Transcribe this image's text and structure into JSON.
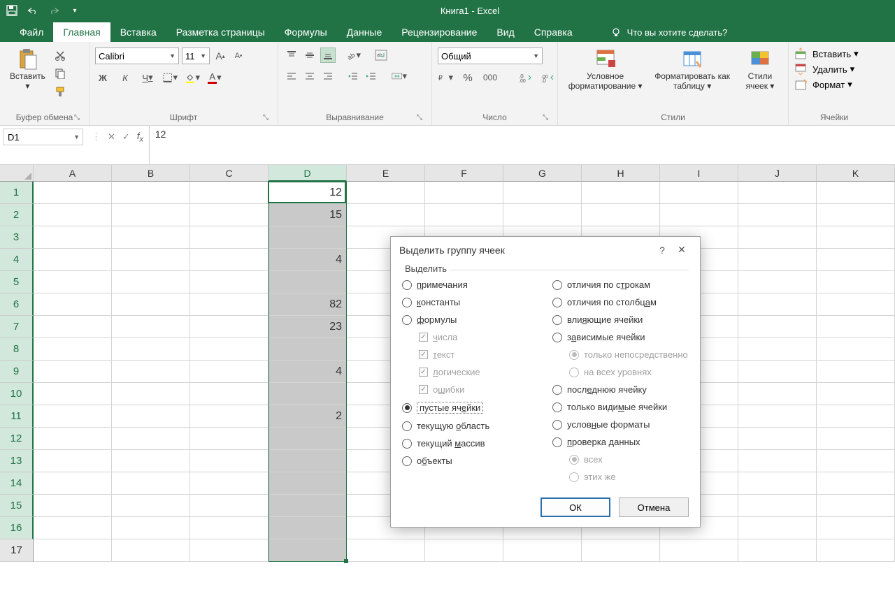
{
  "title": "Книга1  -  Excel",
  "tabs": {
    "file": "Файл",
    "home": "Главная",
    "insert": "Вставка",
    "layout": "Разметка страницы",
    "formulas": "Формулы",
    "data": "Данные",
    "review": "Рецензирование",
    "view": "Вид",
    "help": "Справка"
  },
  "tell_me": "Что вы хотите сделать?",
  "ribbon": {
    "clipboard": {
      "paste": "Вставить",
      "label": "Буфер обмена"
    },
    "font": {
      "name": "Calibri",
      "size": "11",
      "bold": "Ж",
      "italic": "К",
      "under": "Ч",
      "label": "Шрифт"
    },
    "align": {
      "label": "Выравнивание"
    },
    "number": {
      "format": "Общий",
      "label": "Число"
    },
    "styles": {
      "cond": "Условное форматирование",
      "table": "Форматировать как таблицу",
      "cell": "Стили ячеек",
      "label": "Стили"
    },
    "cells": {
      "insert": "Вставить",
      "delete": "Удалить",
      "format": "Формат",
      "label": "Ячейки"
    }
  },
  "namebox": "D1",
  "formula": "12",
  "columns": [
    "A",
    "B",
    "C",
    "D",
    "E",
    "F",
    "G",
    "H",
    "I",
    "J",
    "K"
  ],
  "rows": 17,
  "selected_col_index": 3,
  "data_col": {
    "1": "12",
    "2": "15",
    "3": "",
    "4": "4",
    "5": "",
    "6": "82",
    "7": "23",
    "8": "",
    "9": "4",
    "10": "",
    "11": "2"
  },
  "dialog": {
    "title": "Выделить группу ячеек",
    "frame": "Выделить",
    "left": [
      {
        "type": "radio",
        "label": "примечания",
        "u": 0
      },
      {
        "type": "radio",
        "label": "константы",
        "u": 0
      },
      {
        "type": "radio",
        "label": "формулы",
        "u": 0
      },
      {
        "type": "check",
        "label": "числа",
        "u": 0,
        "indent": true,
        "disabled": true,
        "checked": true
      },
      {
        "type": "check",
        "label": "текст",
        "u": 0,
        "indent": true,
        "disabled": true,
        "checked": true
      },
      {
        "type": "check",
        "label": "логические",
        "u": 0,
        "indent": true,
        "disabled": true,
        "checked": true
      },
      {
        "type": "check",
        "label": "ошибки",
        "u": 1,
        "indent": true,
        "disabled": true,
        "checked": true
      },
      {
        "type": "radio",
        "label": "пустые ячейки",
        "u": 9,
        "selected": true,
        "boxed": true
      },
      {
        "type": "radio",
        "label": "текущую область",
        "u": 8
      },
      {
        "type": "radio",
        "label": "текущий массив",
        "u": 8
      },
      {
        "type": "radio",
        "label": "объекты",
        "u": 1
      }
    ],
    "right": [
      {
        "type": "radio",
        "label": "отличия по строкам",
        "u": 12
      },
      {
        "type": "radio",
        "label": "отличия по столбцам",
        "u": 17
      },
      {
        "type": "radio",
        "label": "влияющие ячейки",
        "u": 3
      },
      {
        "type": "radio",
        "label": "зависимые ячейки",
        "u": 1
      },
      {
        "type": "radio",
        "label": "только непосредственно",
        "indent": true,
        "disabled": true,
        "preselected": true
      },
      {
        "type": "radio",
        "label": "на всех уровнях",
        "indent": true,
        "disabled": true
      },
      {
        "type": "radio",
        "label": "последнюю ячейку",
        "u": 4
      },
      {
        "type": "radio",
        "label": "только видимые ячейки",
        "u": 11
      },
      {
        "type": "radio",
        "label": "условные форматы",
        "u": 5
      },
      {
        "type": "radio",
        "label": "проверка данных",
        "u": 0
      },
      {
        "type": "radio",
        "label": "всех",
        "indent": true,
        "disabled": true,
        "preselected": true
      },
      {
        "type": "radio",
        "label": "этих же",
        "indent": true,
        "disabled": true
      }
    ],
    "ok": "ОК",
    "cancel": "Отмена"
  }
}
